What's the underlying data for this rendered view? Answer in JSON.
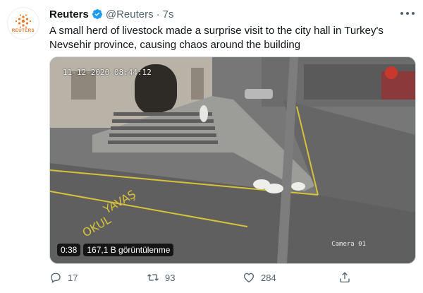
{
  "account": {
    "display_name": "Reuters",
    "handle": "@Reuters",
    "separator": "·",
    "time": "7s",
    "avatar_text": "REUTERS"
  },
  "tweet": {
    "text": "A small herd of livestock made a surprise visit to the city hall in Turkey's Nevsehir province, causing chaos around the building"
  },
  "video": {
    "timestamp_overlay": "11-12-2020 08:44:12",
    "camera_label": "Camera 01",
    "duration": "0:38",
    "views": "167,1 B görüntülenme",
    "road_text_1": "YAVAŞ",
    "road_text_2": "OKUL"
  },
  "actions": {
    "replies": "17",
    "retweets": "93",
    "likes": "284"
  },
  "colors": {
    "brand_orange": "#e87722",
    "verified_blue": "#1d9bf0",
    "muted_gray": "#536471"
  },
  "icons": [
    "reuters-logo-icon",
    "verified-badge-icon",
    "more-options-icon",
    "reply-icon",
    "retweet-icon",
    "like-icon",
    "share-icon"
  ]
}
